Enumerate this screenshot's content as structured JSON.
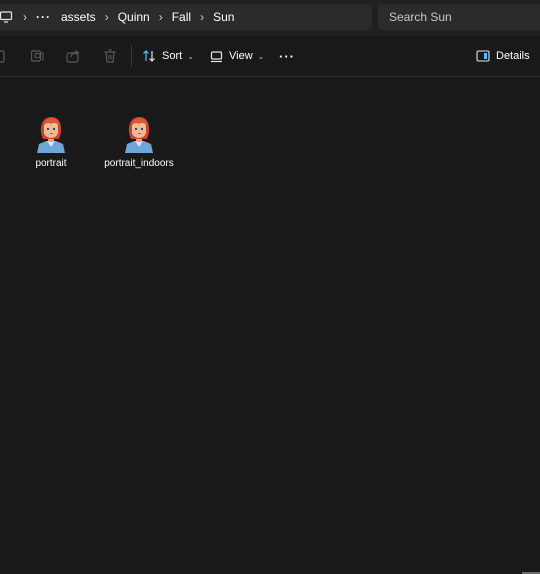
{
  "breadcrumb": {
    "pc_icon": "computer-icon",
    "overflow_label": "···",
    "items": [
      "assets",
      "Quinn",
      "Fall",
      "Sun"
    ]
  },
  "search": {
    "placeholder": "Search Sun"
  },
  "toolbar": {
    "copy_icon": "copy-icon",
    "paste_icon": "paste-icon",
    "share_icon": "share-icon",
    "delete_icon": "delete-icon",
    "sort_label": "Sort",
    "view_label": "View",
    "more_label": "···",
    "details_label": "Details"
  },
  "files": [
    {
      "name": "portrait",
      "icon": "portrait-thumbnail"
    },
    {
      "name": "portrait_indoors",
      "icon": "portrait-thumbnail"
    }
  ],
  "colors": {
    "background": "#191919",
    "bar": "#202020",
    "field": "#2b2b2b",
    "accent": "#4cc2ff"
  }
}
